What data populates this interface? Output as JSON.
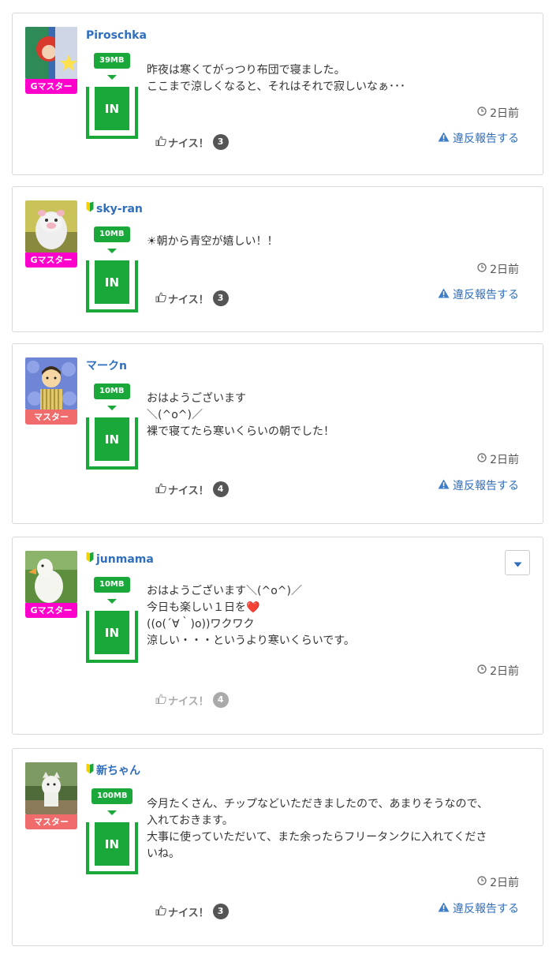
{
  "posts": [
    {
      "username": "Piroschka",
      "beginner": false,
      "rank": "Gマスター",
      "rank_color": "#ff00cc",
      "mb": "39MB",
      "tank_label": "IN",
      "lines": [
        "昨夜は寒くてがっつり布団で寝ました。",
        "ここまで涼しくなると、それはそれで寂しいなぁ･･･"
      ],
      "time": "2日前",
      "nice_label": "ナイス！",
      "nice_count": "3",
      "report": "違反報告する"
    },
    {
      "username": "sky-ran",
      "beginner": true,
      "rank": "Gマスター",
      "rank_color": "#ff00cc",
      "mb": "10MB",
      "tank_label": "IN",
      "lines": [
        "☀朝から青空が嬉しい！！"
      ],
      "time": "2日前",
      "nice_label": "ナイス！",
      "nice_count": "3",
      "report": "違反報告する"
    },
    {
      "username": "マークn",
      "beginner": false,
      "rank": "マスター",
      "rank_color": "#f06b6b",
      "mb": "10MB",
      "tank_label": "IN",
      "lines": [
        "おはようございます",
        "＼(^o^)／",
        "裸で寝てたら寒いくらいの朝でした！"
      ],
      "time": "2日前",
      "nice_label": "ナイス！",
      "nice_count": "4",
      "report": "違反報告する"
    },
    {
      "username": "junmama",
      "beginner": true,
      "rank": "Gマスター",
      "rank_color": "#ff00cc",
      "mb": "10MB",
      "tank_label": "IN",
      "lines": [
        "おはようございます＼(^o^)／",
        "今日も楽しい１日を❤️",
        "((o(´∀｀)o))ワクワク",
        "涼しい・・・というより寒いくらいです。"
      ],
      "time": "2日前",
      "nice_label": "ナイス！",
      "nice_count": "4",
      "report": ""
    },
    {
      "username": "新ちゃん",
      "beginner": true,
      "rank": "マスター",
      "rank_color": "#f06b6b",
      "mb": "100MB",
      "tank_label": "IN",
      "lines": [
        "今月たくさん、チップなどいただきましたので、あまりそうなので、",
        "入れておきます。",
        "大事に使っていただいて、また余ったらフリータンクに入れてくださ",
        "いね。"
      ],
      "time": "2日前",
      "nice_label": "ナイス！",
      "nice_count": "3",
      "report": "違反報告する"
    }
  ]
}
